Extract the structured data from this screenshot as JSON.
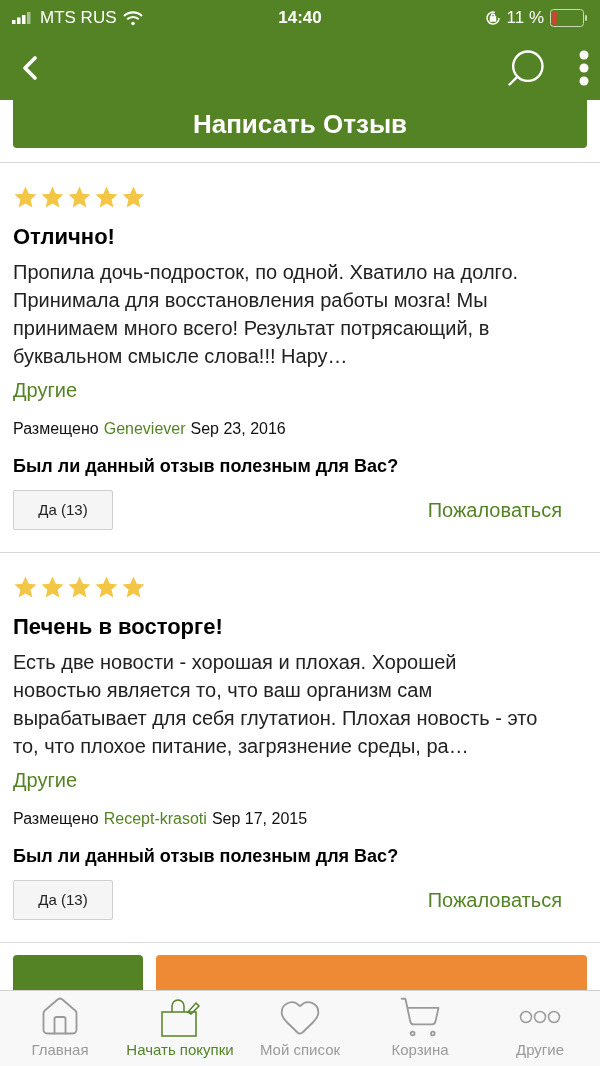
{
  "status_bar": {
    "carrier": "MTS RUS",
    "time": "14:40",
    "battery": "11 %"
  },
  "write_review_button": "Написать Отзыв",
  "reviews": [
    {
      "stars": 5,
      "title": "Отлично!",
      "body": "Пропила дочь-подросток, по одной. Хватило на долго. Принимала для восстановления работы мозга! Мы принимаем много всего! Результат потрясающий, в буквальном смысле слова!!! Нару…",
      "more": "Другие",
      "posted_label": "Размещено",
      "author": "Geneviever",
      "date": "Sep 23, 2016",
      "helpful_question": "Был ли данный отзыв полезным для Вас?",
      "yes_button": "Да (13)",
      "report_link": "Пожаловаться"
    },
    {
      "stars": 5,
      "title": "Печень в восторге!",
      "body": "Есть две новости - хорошая и плохая. Хорошей новостью является то, что ваш организм сам вырабатывает для себя глутатион. Плохая новость - это то, что плохое питание, загрязнение среды, ра…",
      "more": "Другие",
      "posted_label": "Размещено",
      "author": "Recept-krasoti",
      "date": "Sep 17, 2015",
      "helpful_question": "Был ли данный отзыв полезным для Вас?",
      "yes_button": "Да (13)",
      "report_link": "Пожаловаться"
    }
  ],
  "tab_bar": [
    {
      "kind": "home",
      "label": "Главная",
      "selected": false
    },
    {
      "kind": "shop",
      "label": "Начать покупки",
      "selected": true
    },
    {
      "kind": "list",
      "label": "Мой список",
      "selected": false
    },
    {
      "kind": "cart",
      "label": "Корзина",
      "selected": false
    },
    {
      "kind": "more",
      "label": "Другие",
      "selected": false
    }
  ]
}
